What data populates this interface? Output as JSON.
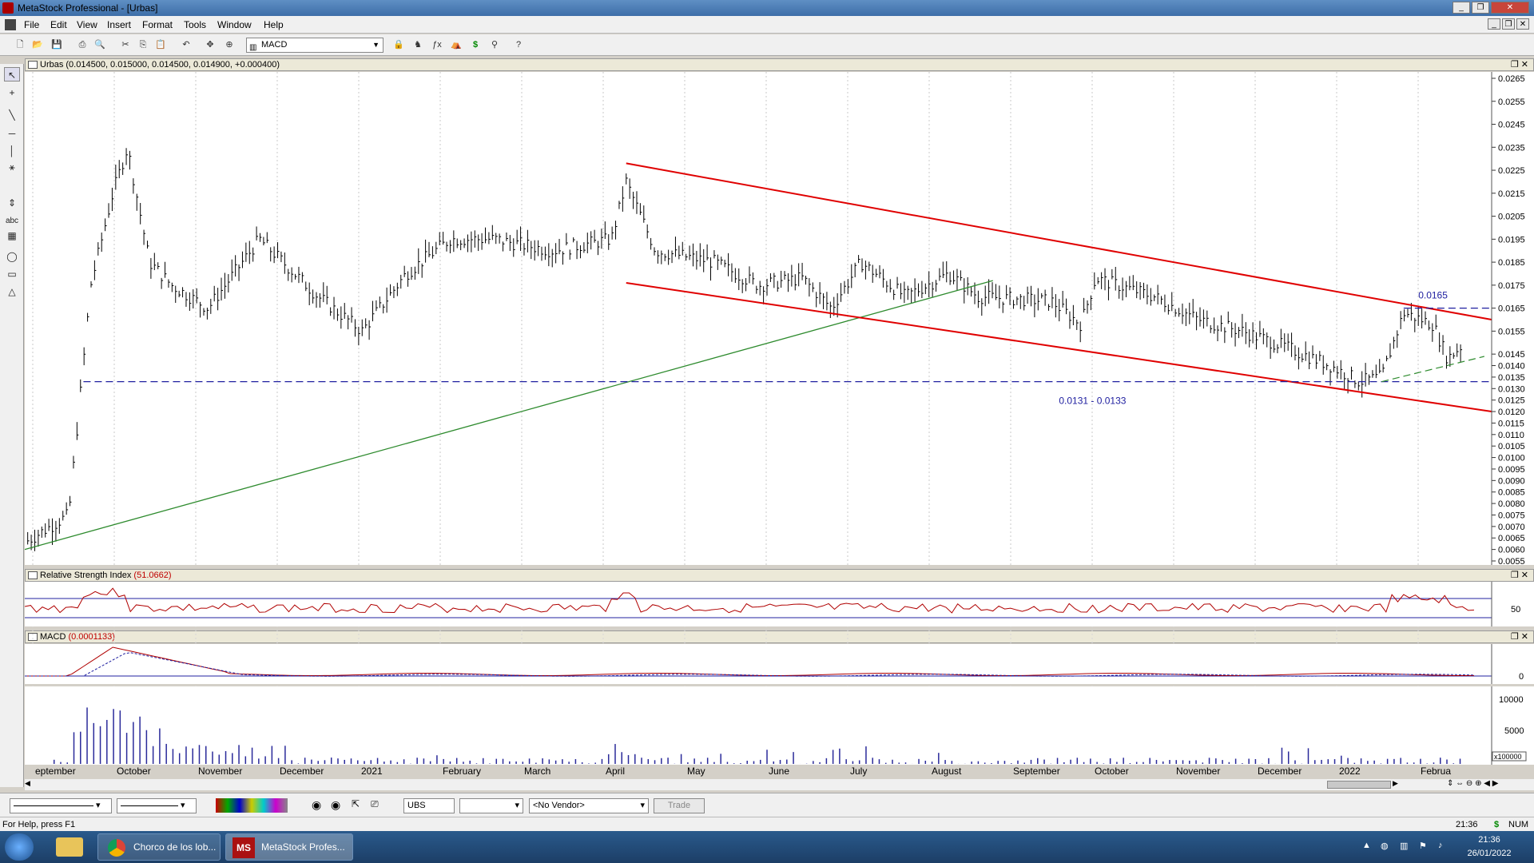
{
  "window": {
    "title": "MetaStock Professional - [Urbas]"
  },
  "menu": [
    "File",
    "Edit",
    "View",
    "Insert",
    "Format",
    "Tools",
    "Window",
    "Help"
  ],
  "toolbar": {
    "indicator_select": "MACD"
  },
  "left_tools": {
    "text_tool": "abc"
  },
  "price_pane": {
    "header": "Urbas (0.014500, 0.015000, 0.014500, 0.014900, +0.000400)",
    "annotation_top": "0.0165",
    "annotation_support": "0.0131 - 0.0133",
    "y_ticks": [
      "0.0265",
      "0.0255",
      "0.0245",
      "0.0235",
      "0.0225",
      "0.0215",
      "0.0205",
      "0.0195",
      "0.0185",
      "0.0175",
      "0.0165",
      "0.0155",
      "0.0145",
      "0.0140",
      "0.0135",
      "0.0130",
      "0.0125",
      "0.0120",
      "0.0115",
      "0.0110",
      "0.0105",
      "0.0100",
      "0.0095",
      "0.0090",
      "0.0085",
      "0.0080",
      "0.0075",
      "0.0070",
      "0.0065",
      "0.0060",
      "0.0055"
    ]
  },
  "rsi_pane": {
    "header_label": "Relative Strength Index",
    "header_value": "(51.0662)",
    "y_tick": "50"
  },
  "macd_pane": {
    "header_label": "MACD",
    "header_value": "(0.0001133)",
    "y_tick": "0"
  },
  "volume_pane": {
    "y_ticks": [
      "10000",
      "5000"
    ],
    "scale_label": "x100000"
  },
  "x_axis_labels": [
    "eptember",
    "October",
    "November",
    "December",
    "2021",
    "February",
    "March",
    "April",
    "May",
    "June",
    "July",
    "August",
    "September",
    "October",
    "November",
    "December",
    "2022",
    "Februa"
  ],
  "bottom": {
    "symbol": "UBS",
    "vendor": "<No Vendor>",
    "trade_button": "Trade"
  },
  "status": {
    "help": "For Help, press F1",
    "time": "21:36",
    "dollar": "$",
    "num": "NUM"
  },
  "taskbar": {
    "tasks": [
      "Chorco de los lob...",
      "MetaStock Profes..."
    ],
    "clock_time": "21:36",
    "clock_date": "26/01/2022"
  },
  "colors": {
    "channel": "#e00000",
    "trendline": "#2e8b2e",
    "support": "#2020a0",
    "price_bars": "#000000",
    "rsi": "#b00000",
    "macd": "#b00000",
    "volume": "#2a2a9a"
  },
  "chart_data": {
    "type": "bar",
    "title": "Urbas",
    "x_labels": [
      "eptember",
      "October",
      "November",
      "December",
      "2021",
      "February",
      "March",
      "April",
      "May",
      "June",
      "July",
      "August",
      "September",
      "October",
      "November",
      "December",
      "2022",
      "Februa"
    ],
    "ylim": [
      0.0055,
      0.0265
    ],
    "price_path": [
      {
        "x": 0,
        "y": 0.0063
      },
      {
        "x": 0.03,
        "y": 0.0075
      },
      {
        "x": 0.045,
        "y": 0.0175
      },
      {
        "x": 0.06,
        "y": 0.0215
      },
      {
        "x": 0.07,
        "y": 0.0235
      },
      {
        "x": 0.085,
        "y": 0.0185
      },
      {
        "x": 0.1,
        "y": 0.0175
      },
      {
        "x": 0.125,
        "y": 0.0165
      },
      {
        "x": 0.16,
        "y": 0.0195
      },
      {
        "x": 0.2,
        "y": 0.017
      },
      {
        "x": 0.23,
        "y": 0.0155
      },
      {
        "x": 0.26,
        "y": 0.018
      },
      {
        "x": 0.29,
        "y": 0.0195
      },
      {
        "x": 0.32,
        "y": 0.0195
      },
      {
        "x": 0.36,
        "y": 0.019
      },
      {
        "x": 0.4,
        "y": 0.0195
      },
      {
        "x": 0.41,
        "y": 0.022
      },
      {
        "x": 0.43,
        "y": 0.019
      },
      {
        "x": 0.47,
        "y": 0.0185
      },
      {
        "x": 0.5,
        "y": 0.0175
      },
      {
        "x": 0.53,
        "y": 0.0178
      },
      {
        "x": 0.55,
        "y": 0.0165
      },
      {
        "x": 0.57,
        "y": 0.0185
      },
      {
        "x": 0.6,
        "y": 0.017
      },
      {
        "x": 0.63,
        "y": 0.018
      },
      {
        "x": 0.65,
        "y": 0.017
      },
      {
        "x": 0.7,
        "y": 0.0168
      },
      {
        "x": 0.72,
        "y": 0.0158
      },
      {
        "x": 0.73,
        "y": 0.0178
      },
      {
        "x": 0.77,
        "y": 0.017
      },
      {
        "x": 0.8,
        "y": 0.016
      },
      {
        "x": 0.83,
        "y": 0.0155
      },
      {
        "x": 0.86,
        "y": 0.0148
      },
      {
        "x": 0.89,
        "y": 0.014
      },
      {
        "x": 0.91,
        "y": 0.0133
      },
      {
        "x": 0.925,
        "y": 0.0135
      },
      {
        "x": 0.94,
        "y": 0.0163
      },
      {
        "x": 0.96,
        "y": 0.0158
      },
      {
        "x": 0.97,
        "y": 0.0143
      },
      {
        "x": 0.98,
        "y": 0.0149
      }
    ],
    "channel_upper": [
      {
        "x": 0.41,
        "y": 0.0228
      },
      {
        "x": 1.0,
        "y": 0.016
      }
    ],
    "channel_lower": [
      {
        "x": 0.41,
        "y": 0.0176
      },
      {
        "x": 1.0,
        "y": 0.012
      }
    ],
    "trendline": [
      {
        "x": 0.0,
        "y": 0.006
      },
      {
        "x": 0.66,
        "y": 0.0177
      }
    ],
    "support_level": 0.0133,
    "resistance_level": 0.0165,
    "rsi_level": 50,
    "macd_zero": 0
  }
}
